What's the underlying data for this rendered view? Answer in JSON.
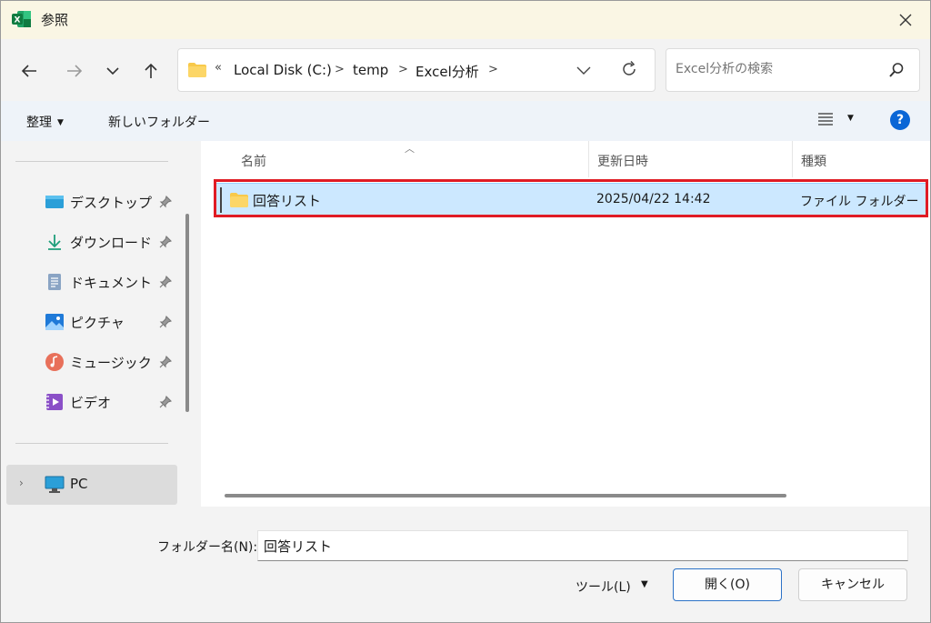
{
  "window": {
    "title": "参照",
    "app_icon": "excel-icon",
    "close_icon": "close-icon"
  },
  "nav": {
    "back_icon": "back-arrow-icon",
    "forward_icon": "forward-arrow-icon",
    "recent_icon": "chevron-down-icon",
    "up_icon": "up-arrow-icon",
    "address": {
      "overflow": "«",
      "segments": [
        "Local Disk (C:)",
        "temp",
        "Excel分析"
      ],
      "separator": ">"
    },
    "search_placeholder": "Excel分析の検索"
  },
  "commands": {
    "organize": "整理",
    "new_folder": "新しいフォルダー"
  },
  "sidebar": {
    "items": [
      {
        "label": "デスクトップ",
        "icon": "desktop-icon"
      },
      {
        "label": "ダウンロード",
        "icon": "download-icon"
      },
      {
        "label": "ドキュメント",
        "icon": "document-icon"
      },
      {
        "label": "ピクチャ",
        "icon": "pictures-icon"
      },
      {
        "label": "ミュージック",
        "icon": "music-icon"
      },
      {
        "label": "ビデオ",
        "icon": "video-icon"
      }
    ],
    "pc_label": "PC"
  },
  "columns": {
    "name": "名前",
    "modified": "更新日時",
    "type": "種類"
  },
  "files": [
    {
      "name": "回答リスト",
      "modified": "2025/04/22 14:42",
      "type": "ファイル フォルダー",
      "selected": true
    }
  ],
  "footer": {
    "folder_name_label": "フォルダー名(N):",
    "folder_name_value": "回答リスト",
    "tools": "ツール(L)",
    "open": "開く(O)",
    "cancel": "キャンセル"
  },
  "colors": {
    "accent": "#0a66d6",
    "selection": "#cce8ff",
    "highlight_box": "#e01b24",
    "folder": "#f8c94a"
  }
}
